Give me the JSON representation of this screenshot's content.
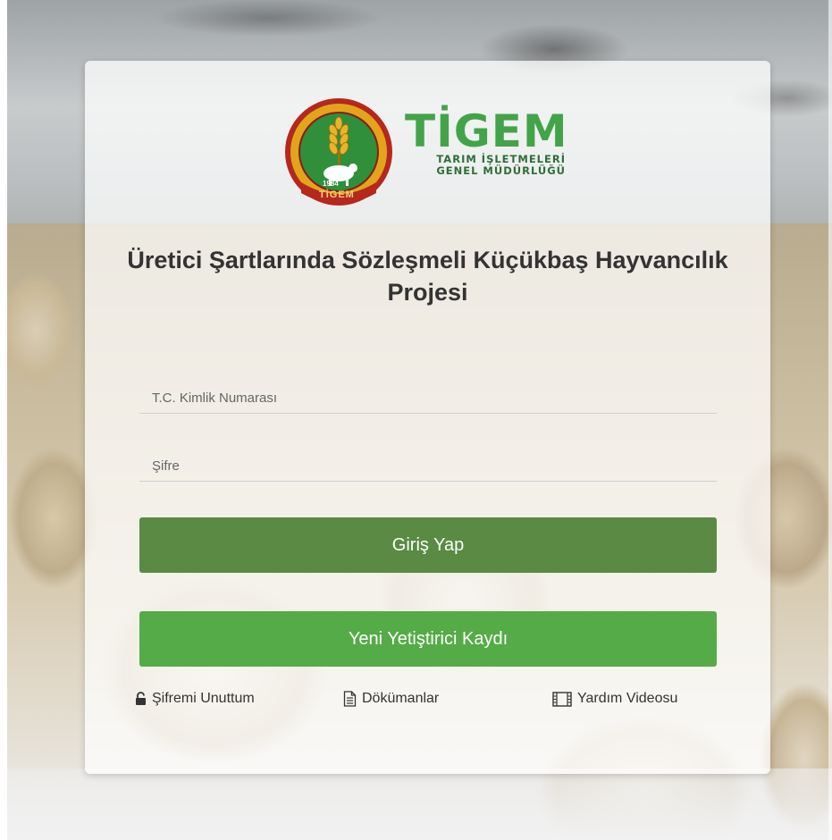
{
  "branding": {
    "name": "TİGEM",
    "subtitle_line1": "TARIM İŞLETMELERİ",
    "subtitle_line2": "GENEL MÜDÜRLÜĞÜ",
    "seal_text": "TİGEM",
    "seal_year": "1984",
    "colors": {
      "primary_green": "#43a349",
      "dark_green": "#2e6d3a",
      "seal_red": "#b5281d",
      "seal_gold": "#e3a41c"
    }
  },
  "login": {
    "title": "Üretici Şartlarında Sözleşmeli Küçükbaş Hayvancılık Projesi",
    "tc_placeholder": "T.C. Kimlik Numarası",
    "password_placeholder": "Şifre",
    "login_button": "Giriş Yap",
    "register_button": "Yeni Yetiştirici Kaydı",
    "button_colors": {
      "login": "#5a8a43",
      "register": "#55ab47"
    }
  },
  "links": [
    {
      "label": "Şifremi Unuttum",
      "icon": "unlock-icon"
    },
    {
      "label": "Dökümanlar",
      "icon": "document-icon"
    },
    {
      "label": "Yardım Videosu",
      "icon": "film-icon"
    }
  ]
}
